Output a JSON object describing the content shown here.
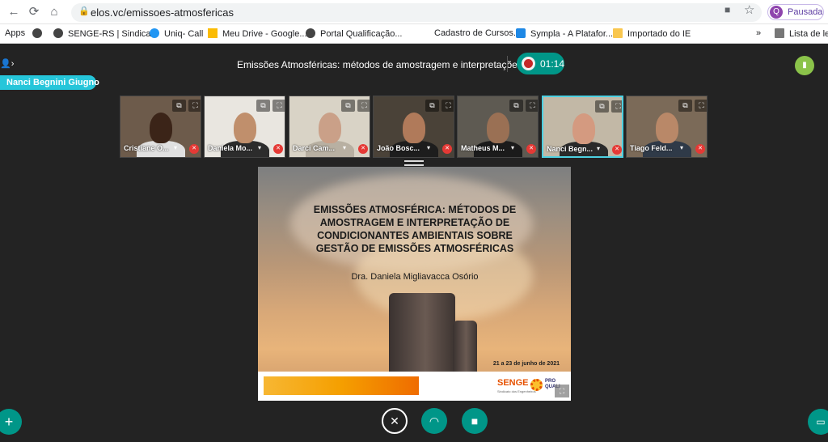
{
  "browser": {
    "url": "elos.vc/emissoes-atmosfericas",
    "profile_initial": "Q",
    "profile_label": "Pausada",
    "bookmarks": [
      "Apps",
      "SENGE-RS | Sindica...",
      "Uniq- Call",
      "Meu Drive - Google...",
      "Portal Qualificação...",
      "Cadastro de Cursos...",
      "Sympla - A Platafor...",
      "Importado do IE",
      "Lista de leit"
    ]
  },
  "meeting": {
    "title": "Emissões Atmosféricas: métodos de amostragem e interpretações de c...",
    "timer": "01:14",
    "active_speaker": "Nanci Begnini Giugno",
    "participants": [
      {
        "name": "Cristiane O...",
        "bg": "#6d5b4b",
        "skin": "#3b2418",
        "shirt": "#e0e0e0"
      },
      {
        "name": "Daniela Mo...",
        "bg": "#e9e6e0",
        "skin": "#c08f6c",
        "shirt": "#2c2c2c"
      },
      {
        "name": "Darci Cam...",
        "bg": "#d9d3c6",
        "skin": "#caa088",
        "shirt": "#b8b0a2"
      },
      {
        "name": "João Bosc...",
        "bg": "#4a4238",
        "skin": "#b07a5a",
        "shirt": "#1d1d1d"
      },
      {
        "name": "Matheus M...",
        "bg": "#5e5a52",
        "skin": "#9a7054",
        "shirt": "#1b1b1b"
      },
      {
        "name": "Nanci Begn...",
        "bg": "#c2b8a6",
        "skin": "#d49a80",
        "shirt": "#2a2a2a"
      },
      {
        "name": "Tiago Feld...",
        "bg": "#7b6a58",
        "skin": "#b98868",
        "shirt": "#2f3a48"
      }
    ]
  },
  "slide": {
    "title_lines": [
      "EMISSÕES ATMOSFÉRICA: MÉTODOS DE",
      "AMOSTRAGEM E INTERPRETAÇÃO DE",
      "CONDICIONANTES AMBIENTAIS SOBRE",
      "GESTÃO DE EMISSÕES ATMOSFÉRICAS"
    ],
    "author": "Dra. Daniela Migliavacca Osório",
    "date": "21 a 23 de junho de 2021",
    "logo_senge": "SENGE",
    "logo_senge_sub": "Sindicato dos Engenheiros",
    "logo_proquali": "PRO QUALI"
  },
  "icons": {
    "back": "←",
    "forward": "→",
    "reload": "⟳",
    "home": "⌂",
    "lock": "🔒",
    "star": "☆",
    "cam": "■",
    "people": "👤›",
    "expand": "⧉",
    "fullscreen": "⛶",
    "caret": "▾",
    "mute": "✕",
    "signal": "▮",
    "mic_off": "🎙",
    "headset": "🎧",
    "video": "▶",
    "plus": "+",
    "chat": "▭"
  }
}
